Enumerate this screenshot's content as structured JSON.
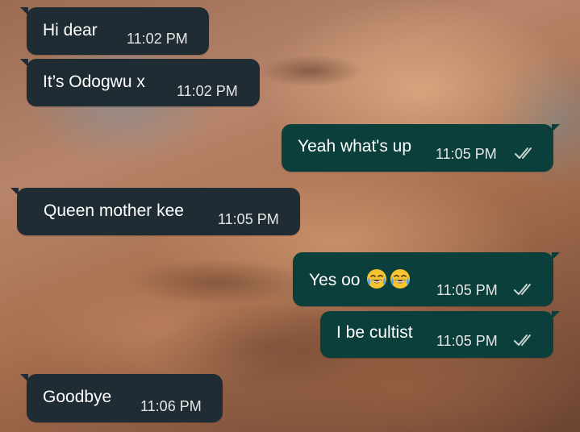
{
  "chat": {
    "messages": [
      {
        "direction": "incoming",
        "text": "Hi dear",
        "time": "11:02 PM"
      },
      {
        "direction": "incoming",
        "text": "It’s Odogwu x",
        "time": "11:02 PM"
      },
      {
        "direction": "outgoing",
        "text": "Yeah what's up",
        "time": "11:05 PM",
        "status": "read"
      },
      {
        "direction": "incoming",
        "text": "Queen mother kee",
        "time": "11:05 PM"
      },
      {
        "direction": "outgoing",
        "text": "Yes oo",
        "emoji": [
          "face-with-tears-of-joy",
          "face-with-tears-of-joy"
        ],
        "time": "11:05 PM",
        "status": "read"
      },
      {
        "direction": "outgoing",
        "text": "I be cultist",
        "time": "11:05 PM",
        "status": "read"
      },
      {
        "direction": "incoming",
        "text": "Goodbye",
        "time": "11:06 PM"
      }
    ]
  },
  "colors": {
    "incoming_bubble": "#202c33",
    "outgoing_bubble": "#0b3f3b",
    "read_tick": "#c9d4d2"
  },
  "icons": {
    "read_receipt": "double-check-icon",
    "emoji": "face-with-tears-of-joy-icon"
  }
}
